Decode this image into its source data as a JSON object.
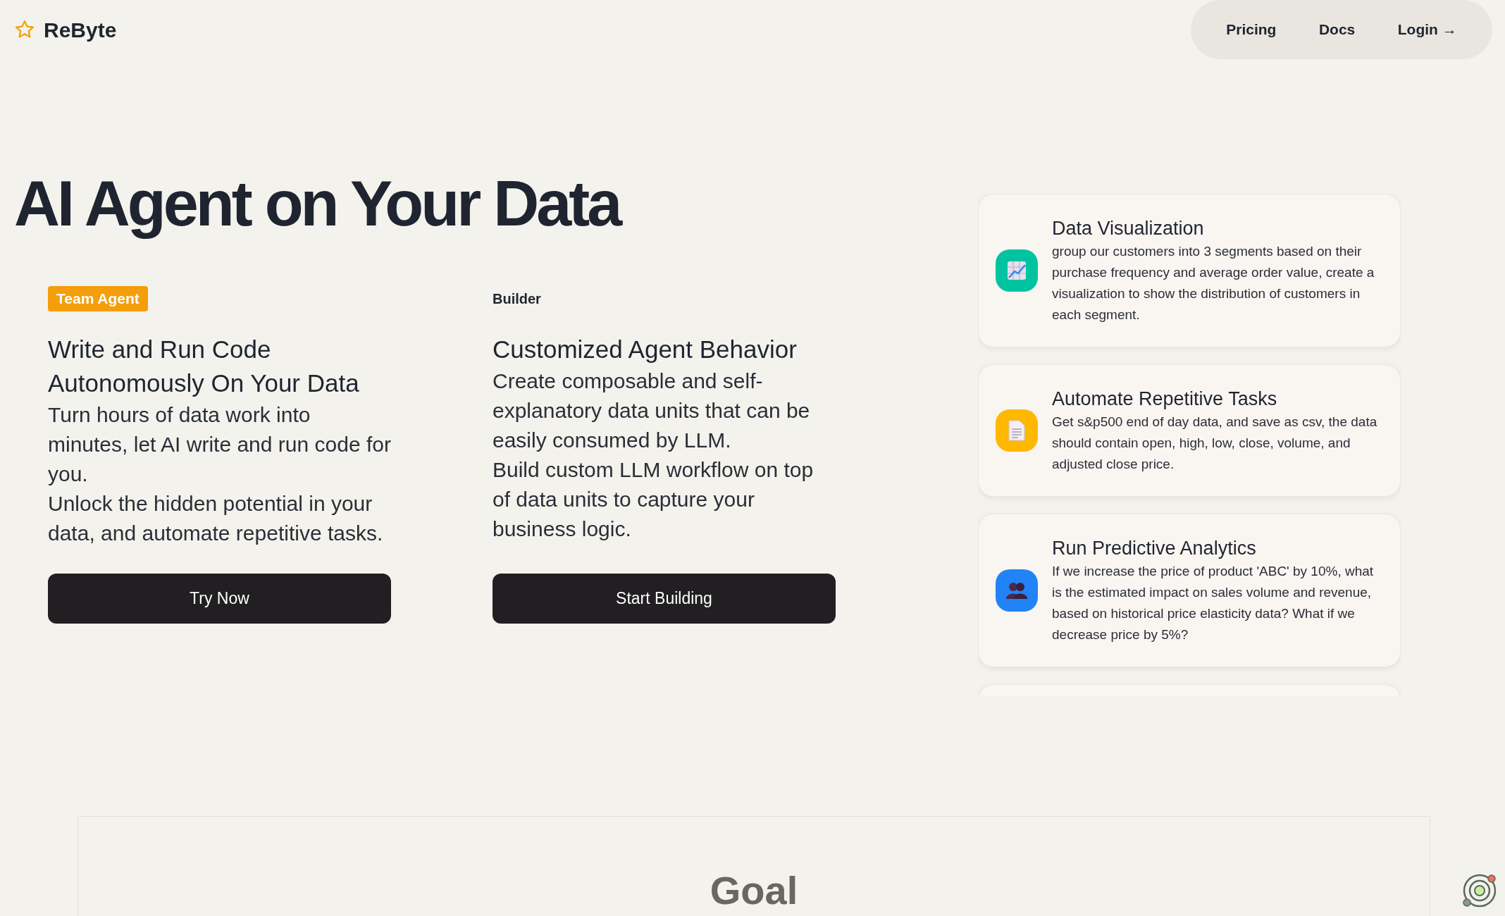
{
  "header": {
    "brand": "ReByte",
    "nav": [
      {
        "label": "Pricing",
        "kind": "link"
      },
      {
        "label": "Docs",
        "kind": "link"
      },
      {
        "label": "Login →",
        "kind": "link"
      }
    ]
  },
  "hero": {
    "title": "AI Agent on Your Data"
  },
  "columns": [
    {
      "tag": "Team Agent",
      "kind": "badge",
      "heading": "Write and Run Code Autonomously On Your Data",
      "paragraphs": [
        "Turn hours of data work into minutes, let AI write and run code for you.",
        "Unlock the hidden potential in your data, and automate repetitive tasks."
      ],
      "button": "Try Now"
    },
    {
      "tag": "Builder",
      "kind": "plain",
      "heading": "Customized Agent Behavior",
      "paragraphs": [
        "Create composable and self-explanatory data units that can be easily consumed by LLM.",
        "Build custom LLM workflow on top of data units to capture your business logic."
      ],
      "button": "Start Building"
    }
  ],
  "examples": [
    {
      "title": "Data Visualization",
      "text": "group our customers into 3 segments based on their purchase frequency and average order value, create a visualization to show the distribution of customers in each segment.",
      "kind": "chart",
      "color": "#00c4a0"
    },
    {
      "title": "Automate Repetitive Tasks",
      "text": "Get s&p500 end of day data, and save as csv, the data should contain open, high, low, close, volume, and adjusted close price.",
      "kind": "document",
      "color": "#ffb800"
    },
    {
      "title": "Run Predictive Analytics",
      "text": "If we increase the price of product 'ABC' by 10%, what is the estimated impact on sales volume and revenue, based on historical price elasticity data? What if we decrease price by 5%?",
      "kind": "people",
      "color": "#2283f6"
    }
  ],
  "goal": {
    "heading": "Goal"
  }
}
